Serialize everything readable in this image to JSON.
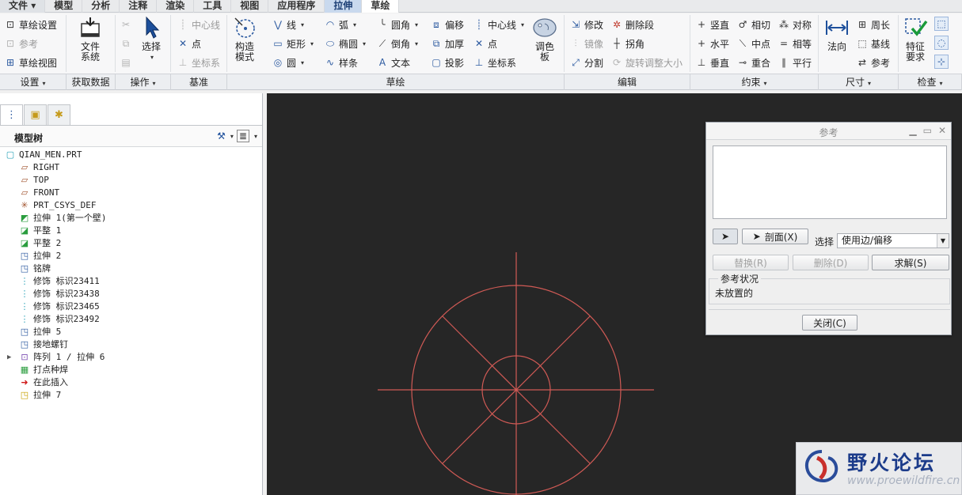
{
  "menu": {
    "file": "文件",
    "items": [
      "模型",
      "分析",
      "注释",
      "渲染",
      "工具",
      "视图",
      "应用程序",
      "拉伸",
      "草绘"
    ]
  },
  "ribbon": {
    "setup": {
      "sketch_setup": "草绘设置",
      "reference": "参考",
      "sketch_view": "草绘视图"
    },
    "get_data": {
      "file_system": [
        "文件",
        "系统"
      ]
    },
    "operations": {
      "select": "选择"
    },
    "datum": {
      "centerline": "中心线",
      "point": "点",
      "csys": "坐标系"
    },
    "sketch": {
      "construction": [
        "构造",
        "模式"
      ],
      "line": "线",
      "rectangle": "矩形",
      "circle": "圆",
      "arc": "弧",
      "ellipse": "椭圆",
      "spline": "样条",
      "fillet": "圆角",
      "chamfer": "倒角",
      "text": "文本",
      "offset": "偏移",
      "thicken": "加厚",
      "project": "投影",
      "centerline": "中心线",
      "point": "点",
      "csys": "坐标系",
      "palette": [
        "调色",
        "板"
      ]
    },
    "edit": {
      "modify": "修改",
      "delete_segment": "删除段",
      "mirror": "镜像",
      "corner": "拐角",
      "divide": "分割",
      "rotate_resize": "旋转调整大小"
    },
    "constrain": {
      "vertical": "竖直",
      "tangent": "相切",
      "symmetric": "对称",
      "horizontal": "水平",
      "midpoint": "中点",
      "equal": "相等",
      "perpendicular": "垂直",
      "coincident": "重合",
      "parallel": "平行"
    },
    "dimension": {
      "normal": "法向",
      "perimeter": "周长",
      "baseline": "基线",
      "reference": "参考"
    },
    "inspect": {
      "feature_req": [
        "特征",
        "要求"
      ]
    }
  },
  "groups": [
    "设置",
    "获取数据",
    "操作",
    "基准",
    "草绘",
    "编辑",
    "约束",
    "尺寸",
    "检查"
  ],
  "model_tree": {
    "title": "模型树",
    "items": [
      {
        "label": "QIAN_MEN.PRT",
        "icon": "part-icon"
      },
      {
        "label": "RIGHT",
        "icon": "datum-plane-icon"
      },
      {
        "label": "TOP",
        "icon": "datum-plane-icon"
      },
      {
        "label": "FRONT",
        "icon": "datum-plane-icon"
      },
      {
        "label": "PRT_CSYS_DEF",
        "icon": "csys-icon"
      },
      {
        "label": "拉伸 1(第一个壁)",
        "icon": "first-wall-icon"
      },
      {
        "label": "平整 1",
        "icon": "flat-wall-icon"
      },
      {
        "label": "平整 2",
        "icon": "flat-wall-icon"
      },
      {
        "label": "拉伸 2",
        "icon": "extrude-icon"
      },
      {
        "label": "铭牌",
        "icon": "extrude-icon"
      },
      {
        "label": "修饰 标识23411",
        "icon": "cosmetic-icon"
      },
      {
        "label": "修饰 标识23438",
        "icon": "cosmetic-icon"
      },
      {
        "label": "修饰 标识23465",
        "icon": "cosmetic-icon"
      },
      {
        "label": "修饰 标识23492",
        "icon": "cosmetic-icon"
      },
      {
        "label": "拉伸 5",
        "icon": "extrude-icon"
      },
      {
        "label": "接地螺钉",
        "icon": "extrude-icon"
      },
      {
        "label": "阵列 1 / 拉伸 6",
        "icon": "pattern-icon"
      },
      {
        "label": "打点种焊",
        "icon": "weld-icon"
      },
      {
        "label": "在此插入",
        "icon": "insert-arrow-icon"
      },
      {
        "label": "拉伸 7",
        "icon": "extrude-active-icon"
      }
    ]
  },
  "dialog": {
    "title": "参考",
    "section_button": "剖面(X)",
    "select_label": "选择",
    "select_value": "使用边/偏移",
    "replace": "替换(R)",
    "delete": "删除(D)",
    "solve": "求解(S)",
    "status_legend": "参考状况",
    "status_value": "未放置的",
    "close": "关闭(C)"
  },
  "watermark": {
    "name": "野火论坛",
    "url": "www.proewildfire.cn"
  },
  "colors": {
    "canvas_bg": "#262626",
    "sketch_line": "#d05a55",
    "accent": "#2c5aa0"
  }
}
